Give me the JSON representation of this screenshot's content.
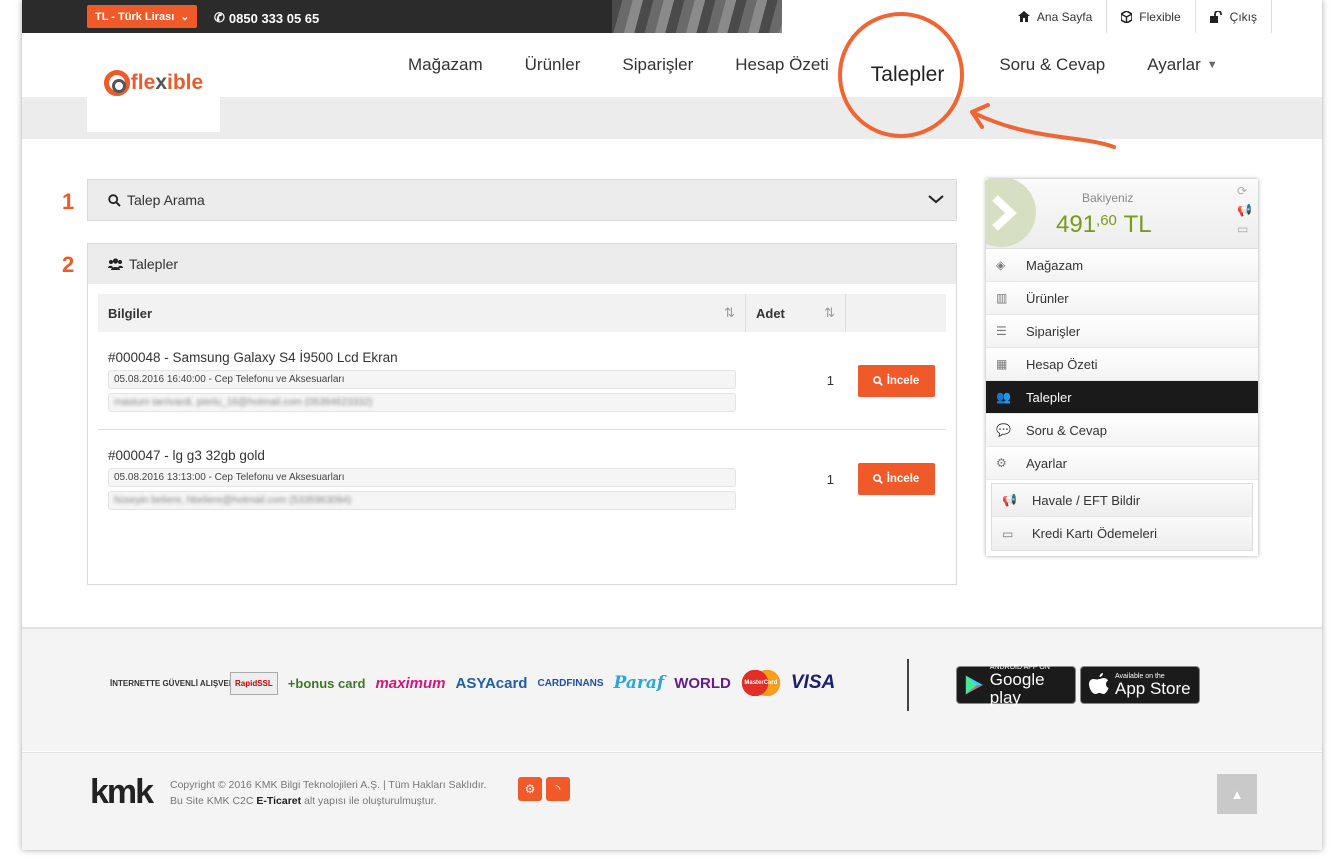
{
  "topbar": {
    "currency": "TL - Türk Lirası",
    "phone": "0850 333 05 65",
    "links": [
      {
        "label": "Ana Sayfa",
        "icon": "home-icon"
      },
      {
        "label": "Flexible",
        "icon": "cube-icon"
      },
      {
        "label": "Çıkış",
        "icon": "unlock-icon"
      }
    ]
  },
  "logo": {
    "text_a": "fle",
    "text_b": "x",
    "text_c": "ible"
  },
  "nav": {
    "items": [
      "Mağazam",
      "Ürünler",
      "Siparişler",
      "Hesap Özeti",
      "Talepler",
      "Soru & Cevap",
      "Ayarlar"
    ],
    "active": "Talepler"
  },
  "annotations": {
    "one": "1",
    "two": "2"
  },
  "search_panel": {
    "title": "Talep Arama"
  },
  "requests_panel": {
    "title": "Talepler",
    "columns": {
      "info": "Bilgiler",
      "qty": "Adet"
    },
    "rows": [
      {
        "title": "#000048 - Samsung Galaxy S4 İ9500 Lcd Ekran",
        "meta": "05.08.2016 16:40:00 - Cep Telefonu ve Aksesuarları",
        "contact": "mastum tarrivardi, pierlu_16@hotmail.com (05394623332)",
        "qty": "1",
        "action": "İncele"
      },
      {
        "title": "#000047 - lg g3 32gb gold",
        "meta": "05.08.2016 13:13:00 - Cep Telefonu ve Aksesuarları",
        "contact": "hüseyin beliere, hbeliere@hotmail.com (5335963094)",
        "qty": "1",
        "action": "İncele"
      }
    ]
  },
  "sidebar": {
    "balance_label": "Bakiyeniz",
    "balance_int": "491",
    "balance_dec": ",60",
    "balance_currency": "TL",
    "items": [
      {
        "label": "Mağazam",
        "icon": "cube-icon"
      },
      {
        "label": "Ürünler",
        "icon": "barcode-icon"
      },
      {
        "label": "Siparişler",
        "icon": "list-icon"
      },
      {
        "label": "Hesap Özeti",
        "icon": "calculator-icon"
      },
      {
        "label": "Talepler",
        "icon": "users-icon",
        "active": true
      },
      {
        "label": "Soru & Cevap",
        "icon": "comment-icon"
      },
      {
        "label": "Ayarlar",
        "icon": "cogs-icon"
      }
    ],
    "sub_items": [
      {
        "label": "Havale / EFT Bildir",
        "icon": "megaphone-icon"
      },
      {
        "label": "Kredi Kartı Ödemeleri",
        "icon": "credit-card-icon"
      }
    ]
  },
  "footer": {
    "payment_logos": [
      "İNTERNETTE GÜVENLİ ALIŞVERİŞ",
      "RapidSSL",
      "+bonus card",
      "maximum",
      "ASYAcard",
      "CARDFINANS",
      "Paraf",
      "WORLD",
      "MasterCard",
      "VISA"
    ],
    "google_play_small": "ANDROID APP ON",
    "google_play_big": "Google play",
    "app_store_small": "Available on the",
    "app_store_big": "App Store",
    "kmk": "kmk",
    "copyright": "Copyright © 2016 KMK Bilgi Teknolojileri A.Ş. | Tüm Hakları Saklıdır.",
    "powered_pre": "Bu Site KMK C2C",
    "powered_bold": "E-Ticaret",
    "powered_post": "alt yapısı ile oluşturulmuştur."
  },
  "colors": {
    "accent": "#f05a28",
    "balance": "#7a9a1a",
    "dark": "#1a1a1a"
  }
}
